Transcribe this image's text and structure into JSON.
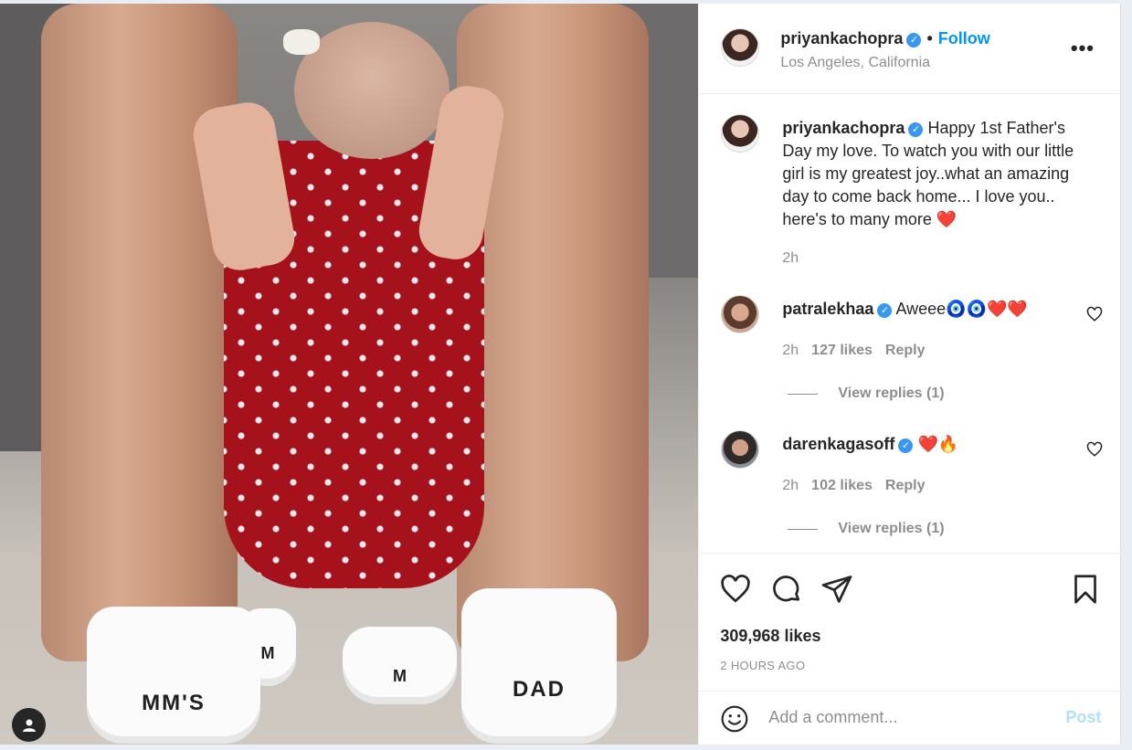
{
  "post": {
    "author": {
      "username": "priyankachopra",
      "location": "Los Angeles, California",
      "follow_label": "Follow"
    },
    "photo": {
      "shoe_big_left": "MM'S",
      "shoe_big_right": "DAD",
      "shoe_small_left": "M",
      "shoe_small_right": "M"
    },
    "caption": {
      "username": "priyankachopra",
      "text": "Happy 1st Father's Day my love. To watch you with our little girl is my greatest joy..what an amazing day to come back home... I love you.. here's to many more",
      "emoji": "❤️",
      "time": "2h"
    },
    "comments": [
      {
        "username": "patralekhaa",
        "text": "Aweee",
        "emojis": "🧿🧿❤️❤️",
        "time": "2h",
        "likes": "127 likes",
        "reply_label": "Reply",
        "view_replies": "View replies (1)"
      },
      {
        "username": "darenkagasoff",
        "text": "",
        "emojis": "❤️🔥",
        "time": "2h",
        "likes": "102 likes",
        "reply_label": "Reply",
        "view_replies": "View replies (1)"
      }
    ],
    "likes_count": "309,968 likes",
    "time_ago": "2 HOURS AGO",
    "comment_input": {
      "placeholder": "Add a comment...",
      "post_label": "Post"
    }
  },
  "icons": {
    "verified": "verified-badge-icon",
    "more": "more-options-icon",
    "like": "heart-icon",
    "comment": "comment-icon",
    "share": "share-icon",
    "save": "bookmark-icon",
    "emoji": "smiley-icon",
    "user": "user-icon"
  },
  "colors": {
    "link_blue": "#0095f6",
    "verified_blue": "#3897f0",
    "muted_text": "#8e8e8e",
    "post_disabled": "#b2dffc",
    "dress_red": "#a5121c"
  }
}
